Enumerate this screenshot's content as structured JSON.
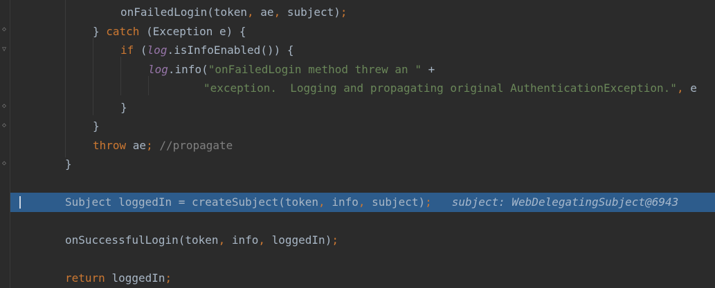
{
  "editor": {
    "lines": [
      {
        "indent": 4,
        "tokens": [
          {
            "t": "ident",
            "v": "onFailedLogin(token"
          },
          {
            "t": "punct",
            "v": ", "
          },
          {
            "t": "ident",
            "v": "ae"
          },
          {
            "t": "punct",
            "v": ", "
          },
          {
            "t": "ident",
            "v": "subject)"
          },
          {
            "t": "punct",
            "v": ";"
          }
        ]
      },
      {
        "indent": 3,
        "tokens": [
          {
            "t": "ident",
            "v": "} "
          },
          {
            "t": "kw",
            "v": "catch "
          },
          {
            "t": "ident",
            "v": "(Exception e) {"
          }
        ]
      },
      {
        "indent": 4,
        "tokens": [
          {
            "t": "kw",
            "v": "if "
          },
          {
            "t": "ident",
            "v": "("
          },
          {
            "t": "field",
            "v": "log"
          },
          {
            "t": "ident",
            "v": ".isInfoEnabled()) {"
          }
        ]
      },
      {
        "indent": 5,
        "tokens": [
          {
            "t": "field",
            "v": "log"
          },
          {
            "t": "ident",
            "v": ".info("
          },
          {
            "t": "str",
            "v": "\"onFailedLogin method threw an \""
          },
          {
            "t": "ident",
            "v": " +"
          }
        ]
      },
      {
        "indent": 7,
        "tokens": [
          {
            "t": "str",
            "v": "\"exception.  Logging and propagating original AuthenticationException.\""
          },
          {
            "t": "punct",
            "v": ", "
          },
          {
            "t": "ident",
            "v": "e"
          }
        ]
      },
      {
        "indent": 4,
        "tokens": [
          {
            "t": "ident",
            "v": "}"
          }
        ]
      },
      {
        "indent": 3,
        "tokens": [
          {
            "t": "ident",
            "v": "}"
          }
        ]
      },
      {
        "indent": 3,
        "tokens": [
          {
            "t": "kw",
            "v": "throw "
          },
          {
            "t": "ident",
            "v": "ae"
          },
          {
            "t": "punct",
            "v": "; "
          },
          {
            "t": "cmt",
            "v": "//propagate"
          }
        ]
      },
      {
        "indent": 2,
        "tokens": [
          {
            "t": "ident",
            "v": "}"
          }
        ]
      },
      {
        "indent": 0,
        "tokens": []
      },
      {
        "indent": 2,
        "highlight": true,
        "tokens": [
          {
            "t": "ident",
            "v": "Subject loggedIn = createSubject(token"
          },
          {
            "t": "punct",
            "v": ", "
          },
          {
            "t": "ident",
            "v": "info"
          },
          {
            "t": "punct",
            "v": ", "
          },
          {
            "t": "ident",
            "v": "subject)"
          },
          {
            "t": "punct",
            "v": ";"
          }
        ],
        "inline_hint": "subject: WebDelegatingSubject@6943"
      },
      {
        "indent": 0,
        "tokens": []
      },
      {
        "indent": 2,
        "tokens": [
          {
            "t": "ident",
            "v": "onSuccessfulLogin(token"
          },
          {
            "t": "punct",
            "v": ", "
          },
          {
            "t": "ident",
            "v": "info"
          },
          {
            "t": "punct",
            "v": ", "
          },
          {
            "t": "ident",
            "v": "loggedIn)"
          },
          {
            "t": "punct",
            "v": ";"
          }
        ]
      },
      {
        "indent": 0,
        "tokens": []
      },
      {
        "indent": 2,
        "tokens": [
          {
            "t": "kw",
            "v": "return "
          },
          {
            "t": "ident",
            "v": "loggedIn"
          },
          {
            "t": "punct",
            "v": ";"
          }
        ]
      }
    ]
  },
  "colors": {
    "background": "#2b2b2b",
    "keyword": "#cc7832",
    "identifier": "#a9b7c6",
    "field": "#9876aa",
    "string": "#6a8759",
    "comment": "#808080",
    "execution_line": "#2d5c8c"
  },
  "gutter": {
    "fold_icons": [
      "fold-end-icon",
      "fold-start-icon",
      "fold-start-icon",
      "fold-end-icon",
      "fold-end-icon",
      "fold-end-icon"
    ]
  }
}
